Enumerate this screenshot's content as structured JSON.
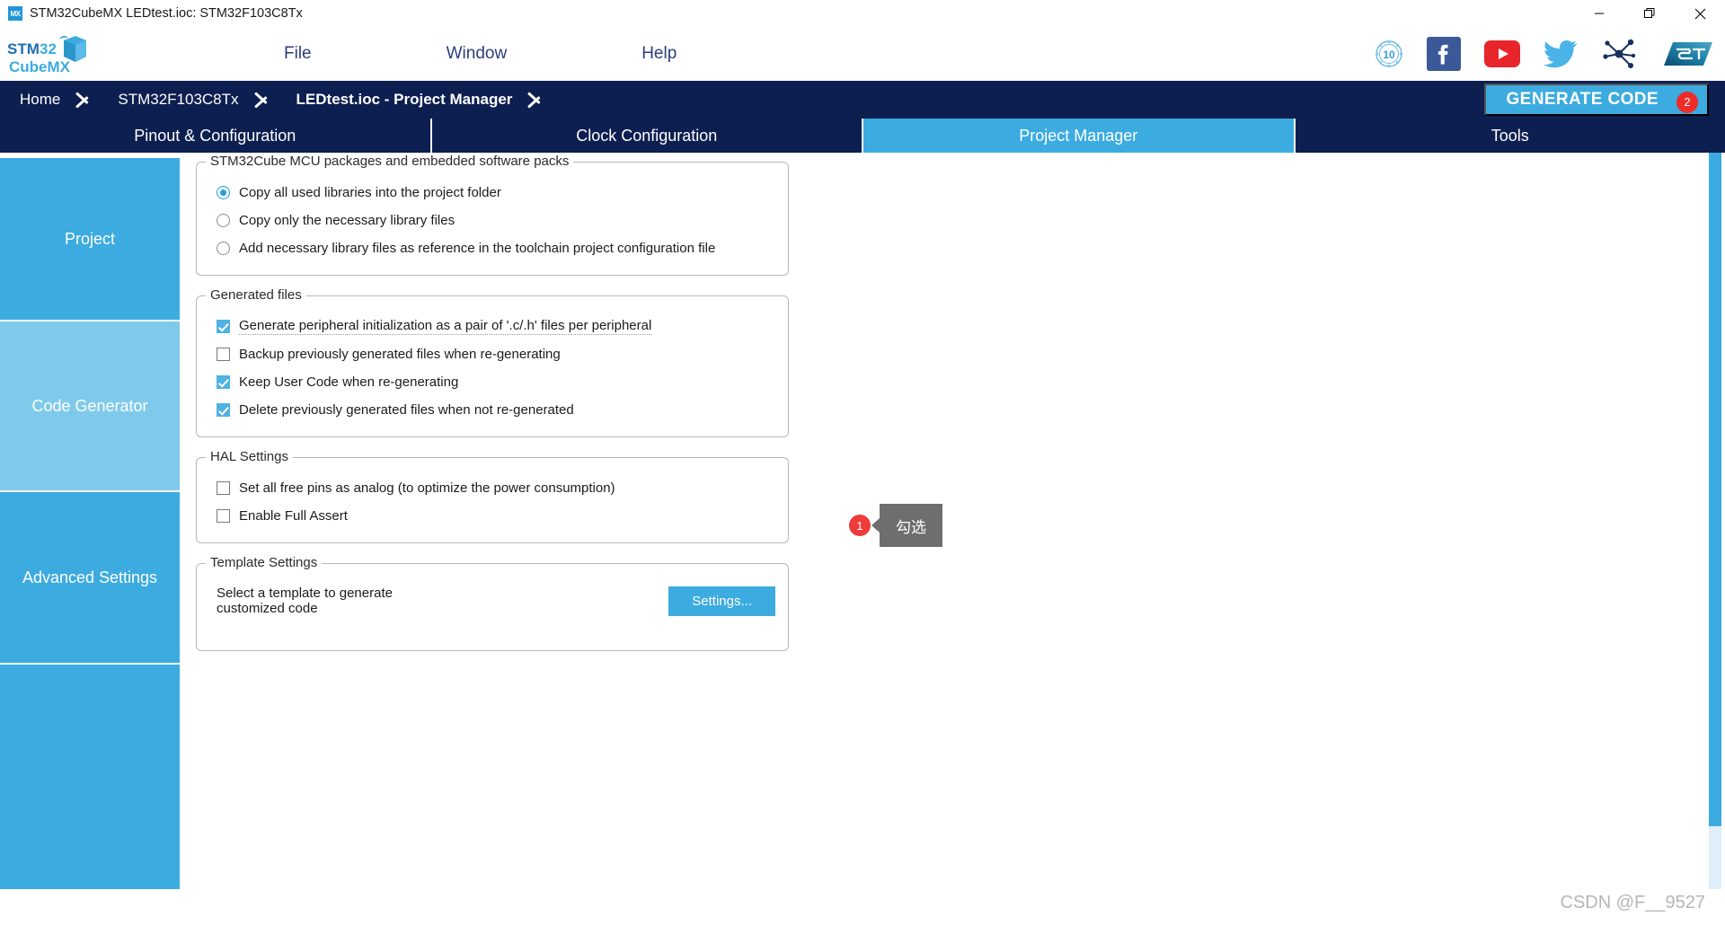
{
  "window": {
    "title": "STM32CubeMX LEDtest.ioc: STM32F103C8Tx",
    "app_icon_text": "MX",
    "controls": {
      "minimize": "minimize-icon",
      "restore": "restore-icon",
      "close": "close-icon"
    }
  },
  "menubar": {
    "logo_line1": "STM32",
    "logo_line2": "CubeMX",
    "items": [
      {
        "label": "File"
      },
      {
        "label": "Window"
      },
      {
        "label": "Help"
      }
    ],
    "social": [
      {
        "name": "ten-years-badge-icon",
        "label": "10"
      },
      {
        "name": "facebook-icon",
        "label": "f"
      },
      {
        "name": "youtube-icon",
        "label": "▶"
      },
      {
        "name": "twitter-icon",
        "label": ""
      },
      {
        "name": "st-community-icon",
        "label": ""
      },
      {
        "name": "st-logo-icon",
        "label": "ST"
      }
    ]
  },
  "breadcrumb": {
    "items": [
      {
        "label": "Home",
        "active": false
      },
      {
        "label": "STM32F103C8Tx",
        "active": false
      },
      {
        "label": "LEDtest.ioc - Project Manager",
        "active": true
      }
    ],
    "generate_button": {
      "label": "GENERATE CODE",
      "badge": "2",
      "badge_color": "#ee2b27",
      "background": "#3cabe0"
    }
  },
  "tabs": [
    {
      "label": "Pinout & Configuration",
      "active": false
    },
    {
      "label": "Clock Configuration",
      "active": false
    },
    {
      "label": "Project Manager",
      "active": true
    },
    {
      "label": "Tools",
      "active": false
    }
  ],
  "sidebar": {
    "items": [
      {
        "label": "Project",
        "selected": false
      },
      {
        "label": "Code Generator",
        "selected": true
      },
      {
        "label": "Advanced Settings",
        "selected": false
      }
    ],
    "accent": "#3cabe0",
    "accent_selected": "#7fcaea"
  },
  "groups": {
    "mcu_packages": {
      "legend": "STM32Cube MCU packages and embedded software packs",
      "options": [
        {
          "label": "Copy all used libraries into the project folder",
          "checked": true
        },
        {
          "label": "Copy only the necessary library files",
          "checked": false
        },
        {
          "label": "Add necessary library files as reference in the toolchain project configuration file",
          "checked": false
        }
      ]
    },
    "generated_files": {
      "legend": "Generated files",
      "options": [
        {
          "label": "Generate peripheral initialization as a pair of '.c/.h' files per peripheral",
          "checked": true,
          "focused": true
        },
        {
          "label": "Backup previously generated files when re-generating",
          "checked": false,
          "focused": false
        },
        {
          "label": "Keep User Code when re-generating",
          "checked": true,
          "focused": false
        },
        {
          "label": "Delete previously generated files when not re-generated",
          "checked": true,
          "focused": false
        }
      ]
    },
    "hal_settings": {
      "legend": "HAL Settings",
      "options": [
        {
          "label": "Set all free pins as analog (to optimize the power consumption)",
          "checked": false
        },
        {
          "label": "Enable Full Assert",
          "checked": false
        }
      ]
    },
    "template_settings": {
      "legend": "Template Settings",
      "description": "Select a template to generate customized code",
      "button_label": "Settings..."
    }
  },
  "annotation": {
    "badge": "1",
    "tooltip": "勾选",
    "badge_color": "#ee3b3b",
    "tooltip_color": "#6e6e6e"
  },
  "footer": {
    "watermark": "CSDN @F__9527"
  }
}
